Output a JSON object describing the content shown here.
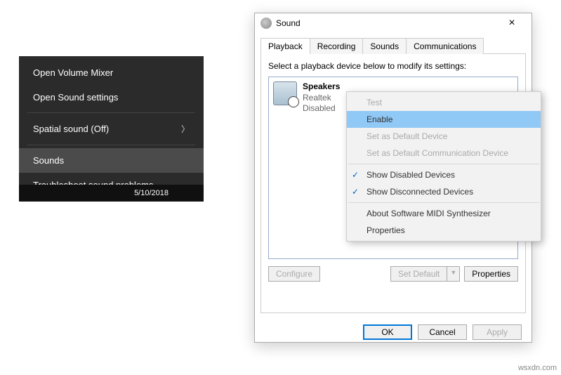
{
  "context_menu": {
    "items": [
      "Open Volume Mixer",
      "Open Sound settings",
      "Spatial sound (Off)",
      "Sounds",
      "Troubleshoot sound problems"
    ],
    "highlighted_index": 3
  },
  "taskbar": {
    "date": "5/10/2018"
  },
  "dialog": {
    "title": "Sound",
    "tabs": [
      "Playback",
      "Recording",
      "Sounds",
      "Communications"
    ],
    "active_tab": 0,
    "instruction": "Select a playback device below to modify its settings:",
    "device": {
      "name": "Speakers",
      "driver": "Realtek",
      "status": "Disabled"
    },
    "buttons": {
      "configure": "Configure",
      "set_default": "Set Default",
      "properties": "Properties"
    },
    "footer": {
      "ok": "OK",
      "cancel": "Cancel",
      "apply": "Apply"
    }
  },
  "device_menu": {
    "items": [
      {
        "label": "Test",
        "enabled": false
      },
      {
        "label": "Enable",
        "enabled": true,
        "highlight": true
      },
      {
        "label": "Set as Default Device",
        "enabled": false
      },
      {
        "label": "Set as Default Communication Device",
        "enabled": false
      },
      {
        "label": "Show Disabled Devices",
        "checked": true
      },
      {
        "label": "Show Disconnected Devices",
        "checked": true
      },
      {
        "label": "About Software MIDI Synthesizer"
      },
      {
        "label": "Properties"
      }
    ]
  },
  "watermark": "wsxdn.com"
}
